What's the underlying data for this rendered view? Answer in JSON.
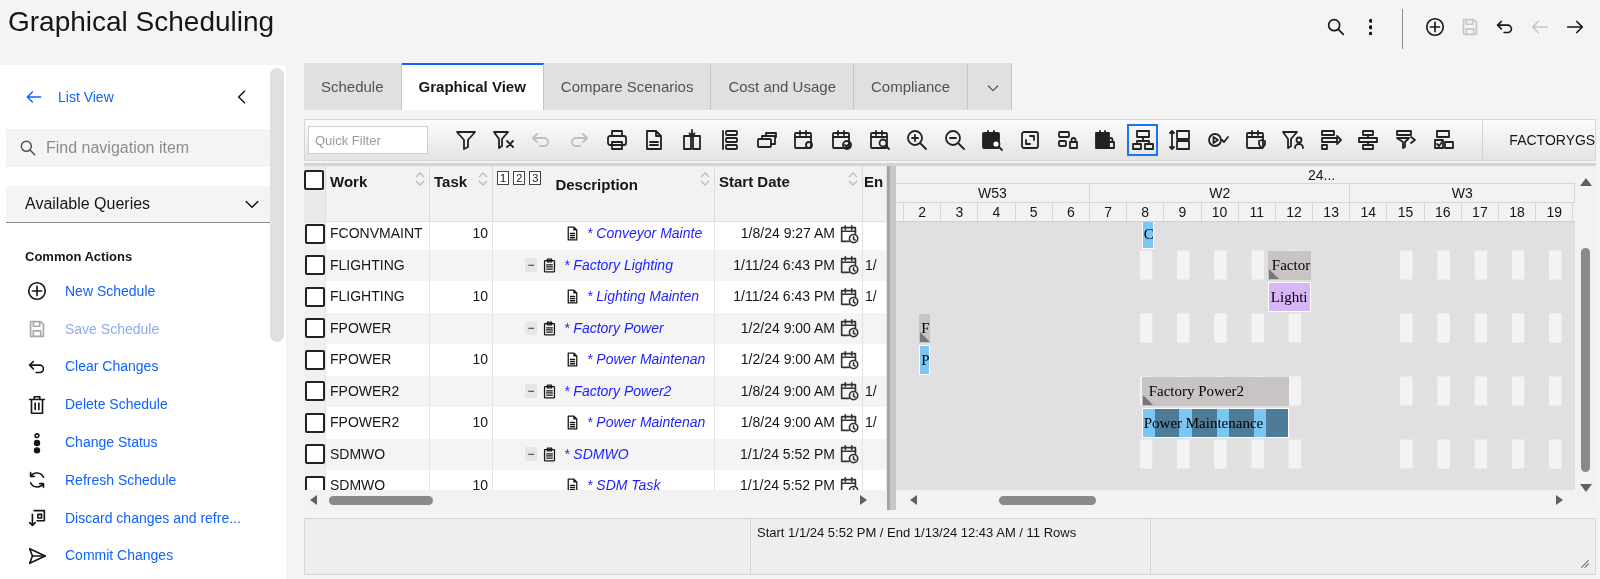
{
  "header": {
    "title": "Graphical Scheduling"
  },
  "header_actions": [
    {
      "kind": "search",
      "disabled": false
    },
    {
      "kind": "more",
      "disabled": false
    },
    {
      "kind": "add",
      "disabled": false
    },
    {
      "kind": "save",
      "disabled": true
    },
    {
      "kind": "undo",
      "disabled": false
    },
    {
      "kind": "back",
      "disabled": true
    },
    {
      "kind": "forward",
      "disabled": false
    }
  ],
  "sidebar": {
    "back_link": "List View",
    "search": {
      "placeholder": "Find navigation item"
    },
    "queries": {
      "label": "Available Queries"
    },
    "section_title": "Common Actions",
    "actions": [
      {
        "label": "New Schedule",
        "kind": "add",
        "disabled": false
      },
      {
        "label": "Save Schedule",
        "kind": "save",
        "disabled": true
      },
      {
        "label": "Clear Changes",
        "kind": "undo",
        "disabled": false
      },
      {
        "label": "Delete Schedule",
        "kind": "delete",
        "disabled": false
      },
      {
        "label": "Change Status",
        "kind": "status",
        "disabled": false
      },
      {
        "label": "Refresh Schedule",
        "kind": "refresh",
        "disabled": false
      },
      {
        "label": "Discard changes and refre...",
        "kind": "discard",
        "disabled": false
      },
      {
        "label": "Commit Changes",
        "kind": "send",
        "disabled": false
      }
    ]
  },
  "tabs": [
    {
      "label": "Schedule",
      "selected": false
    },
    {
      "label": "Graphical View",
      "selected": true
    },
    {
      "label": "Compare Scenarios",
      "selected": false
    },
    {
      "label": "Cost and Usage",
      "selected": false
    },
    {
      "label": "Compliance",
      "selected": false
    }
  ],
  "toolbar": {
    "filter": {
      "placeholder": "Quick Filter"
    },
    "scenario": "FACTORYGS",
    "buttons": [
      {
        "kind": "filter",
        "disabled": false,
        "selected": false
      },
      {
        "kind": "unfilter",
        "disabled": false,
        "selected": false
      },
      {
        "kind": "undo",
        "disabled": true,
        "selected": false
      },
      {
        "kind": "redo",
        "disabled": true,
        "selected": false
      },
      {
        "kind": "print",
        "disabled": false,
        "selected": false
      },
      {
        "kind": "spreadsheet",
        "disabled": false,
        "selected": false
      },
      {
        "kind": "split",
        "disabled": false,
        "selected": false
      },
      {
        "kind": "outline",
        "disabled": false,
        "selected": false
      },
      {
        "kind": "windows",
        "disabled": false,
        "selected": false
      },
      {
        "kind": "calsettings",
        "disabled": false,
        "selected": false
      },
      {
        "kind": "calcheck",
        "disabled": false,
        "selected": false
      },
      {
        "kind": "calsearch",
        "disabled": false,
        "selected": false
      },
      {
        "kind": "zoomin",
        "disabled": false,
        "selected": false
      },
      {
        "kind": "zoomout",
        "disabled": false,
        "selected": false
      },
      {
        "kind": "calsearchdark",
        "disabled": false,
        "selected": false
      },
      {
        "kind": "fit",
        "disabled": false,
        "selected": false
      },
      {
        "kind": "barlock",
        "disabled": false,
        "selected": false
      },
      {
        "kind": "callock",
        "disabled": false,
        "selected": false
      },
      {
        "kind": "hierarchy",
        "disabled": false,
        "selected": true
      },
      {
        "kind": "rowheight",
        "disabled": false,
        "selected": false
      },
      {
        "kind": "playcheck",
        "disabled": false,
        "selected": false
      },
      {
        "kind": "calshield",
        "disabled": false,
        "selected": false
      },
      {
        "kind": "filteruser",
        "disabled": false,
        "selected": false
      },
      {
        "kind": "barcheck",
        "disabled": false,
        "selected": false
      },
      {
        "kind": "barcenter",
        "disabled": false,
        "selected": false
      },
      {
        "kind": "barfilter",
        "disabled": false,
        "selected": false
      },
      {
        "kind": "boxcheck",
        "disabled": false,
        "selected": false
      }
    ]
  },
  "grid": {
    "all_checked": false,
    "columns": [
      "Work",
      "Task",
      "Description",
      "Start Date",
      "En"
    ],
    "levels": [
      "1",
      "2",
      "3"
    ],
    "rows": [
      {
        "checked": false,
        "kind": "task",
        "work": "FCONVMAINT",
        "task": "10",
        "description": "* Conveyor Mainte",
        "start": "1/8/24 9:27 AM"
      },
      {
        "checked": false,
        "kind": "summary",
        "work": "FLIGHTING",
        "toggle": "−",
        "description": "* Factory Lighting",
        "start": "1/11/24 6:43 PM",
        "end": "1/"
      },
      {
        "checked": false,
        "kind": "task",
        "work": "FLIGHTING",
        "task": "10",
        "description": "* Lighting Mainten",
        "start": "1/11/24 6:43 PM",
        "end": "1/"
      },
      {
        "checked": false,
        "kind": "summary",
        "work": "FPOWER",
        "toggle": "−",
        "description": "* Factory Power",
        "start": "1/2/24 9:00 AM"
      },
      {
        "checked": false,
        "kind": "task",
        "work": "FPOWER",
        "task": "10",
        "description": "* Power Maintenan",
        "start": "1/2/24 9:00 AM"
      },
      {
        "checked": false,
        "kind": "summary",
        "work": "FPOWER2",
        "toggle": "−",
        "description": "* Factory Power2",
        "start": "1/8/24 9:00 AM",
        "end": "1/"
      },
      {
        "checked": false,
        "kind": "task",
        "work": "FPOWER2",
        "task": "10",
        "description": "* Power Maintenan",
        "start": "1/8/24 9:00 AM",
        "end": "1/"
      },
      {
        "checked": false,
        "kind": "summary",
        "work": "SDMWO",
        "toggle": "−",
        "description": "* SDMWO",
        "start": "1/1/24 5:52 PM"
      },
      {
        "checked": false,
        "kind": "task",
        "work": "SDMWO",
        "task": "10",
        "description": "* SDM Task",
        "start": "1/1/24 5:52 PM"
      }
    ]
  },
  "gantt": {
    "timescale": "24...",
    "weeks": [
      "W53",
      "W2",
      "W3"
    ],
    "days": [
      "2",
      "3",
      "4",
      "5",
      "6",
      "7",
      "8",
      "9",
      "10",
      "11",
      "12",
      "13",
      "14",
      "15",
      "16",
      "17",
      "18",
      "19"
    ],
    "bars": [
      {
        "label": "C",
        "kind": "task",
        "color": "#7cc6f4"
      },
      {
        "label": "Factor",
        "kind": "summary"
      },
      {
        "label": "Lighti",
        "kind": "task",
        "color": "#d6b6f6"
      },
      {
        "label": "F",
        "kind": "summary"
      },
      {
        "label": "P",
        "kind": "task",
        "color": "#7cc6f4"
      },
      {
        "label": "Factory Power2",
        "kind": "summary"
      },
      {
        "label": "Power Maintenance",
        "kind": "segmented",
        "color": "#7cc6f4"
      }
    ]
  },
  "status_bar": {
    "text": "Start 1/1/24 5:52 PM / End 1/13/24 12:43 AM / 11 Rows"
  }
}
